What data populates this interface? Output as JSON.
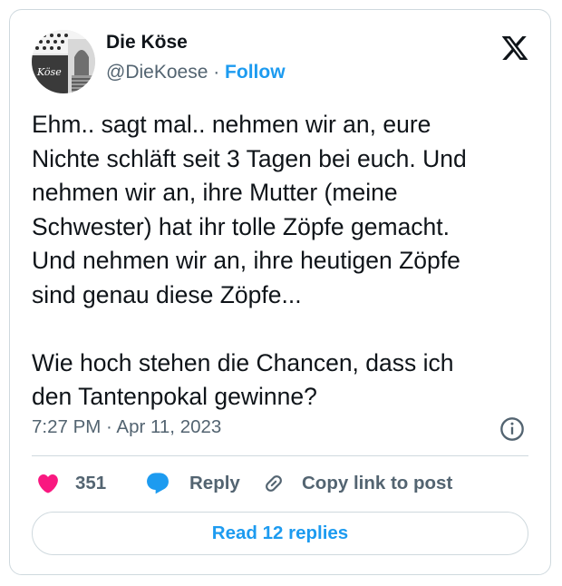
{
  "author": {
    "name": "Die Köse",
    "handle": "@DieKoese",
    "separator": " · ",
    "follow_label": "Follow",
    "avatar_text": "Köse"
  },
  "header": {
    "logo_icon": "x-logo-icon"
  },
  "tweet": {
    "text": "Ehm.. sagt mal.. nehmen wir an, eure\nNichte schläft seit 3 Tagen bei euch. Und\nnehmen wir an, ihre Mutter (meine\nSchwester) hat ihr tolle Zöpfe gemacht.\nUnd nehmen wir an, ihre heutigen Zöpfe\nsind genau diese Zöpfe...\n\nWie hoch stehen die Chancen, dass ich\nden Tantenpokal gewinne?",
    "timestamp": "7:27 PM · Apr 11, 2023",
    "info_icon": "info-icon"
  },
  "actions": {
    "like_count": "351",
    "reply_label": "Reply",
    "copy_label": "Copy link to post"
  },
  "footer": {
    "read_replies_label": "Read 12 replies"
  },
  "colors": {
    "accent": "#1d9bf0",
    "like": "#f91880",
    "secondary_text": "#536471",
    "border": "#cfd9de"
  }
}
